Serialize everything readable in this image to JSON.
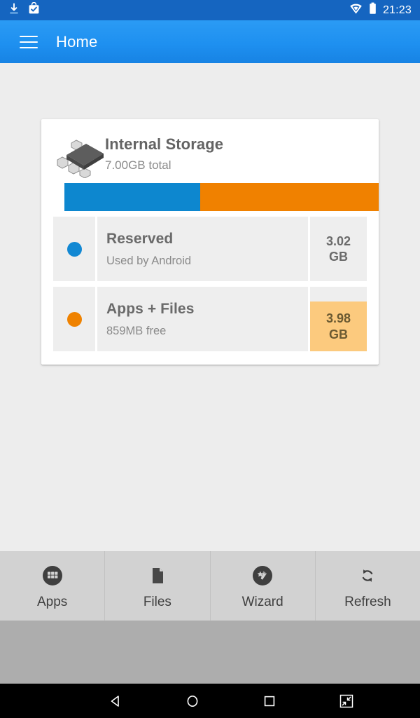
{
  "statusbar": {
    "time": "21:23",
    "icons": [
      "download-icon",
      "app-install-icon",
      "wifi-icon",
      "battery-icon"
    ]
  },
  "appbar": {
    "menu_icon": "hamburger-menu-icon",
    "title": "Home"
  },
  "card": {
    "device_icon": "memory-chip-icon",
    "title": "Internal Storage",
    "subtitle": "7.00GB total",
    "bar": {
      "segments": [
        {
          "name": "Reserved",
          "color": "#0d87cf",
          "percent": 43.2
        },
        {
          "name": "Apps + Files",
          "color": "#f08100",
          "percent": 56.8
        }
      ]
    },
    "rows": [
      {
        "dot_color": "#1288d3",
        "title": "Reserved",
        "subtitle": "Used by Android",
        "value": "3.02\nGB",
        "value_line1": "3.02",
        "value_line2": "GB",
        "highlighted": false
      },
      {
        "dot_color": "#ef8200",
        "title": "Apps + Files",
        "subtitle": "859MB free",
        "value": "3.98\nGB",
        "value_line1": "3.98",
        "value_line2": "GB",
        "highlighted": true,
        "highlight_color": "#fcca7e"
      }
    ]
  },
  "toolbar": {
    "items": [
      {
        "icon": "apps-grid-icon",
        "label": "Apps"
      },
      {
        "icon": "file-document-icon",
        "label": "Files"
      },
      {
        "icon": "magic-wand-icon",
        "label": "Wizard"
      },
      {
        "icon": "refresh-icon",
        "label": "Refresh"
      }
    ]
  },
  "navbar": {
    "items": [
      {
        "icon": "back-triangle-icon"
      },
      {
        "icon": "home-circle-icon"
      },
      {
        "icon": "recents-square-icon"
      },
      {
        "icon": "shrink-window-icon"
      }
    ]
  },
  "colors": {
    "status_bar": "#1565c0",
    "app_bar": "#1e90f0",
    "page_background": "#ededed",
    "card_background": "#ffffff",
    "row_cell": "#eeeeee",
    "accent_blue": "#0d87cf",
    "accent_orange": "#f08100",
    "toolbar": "#d2d2d2"
  }
}
